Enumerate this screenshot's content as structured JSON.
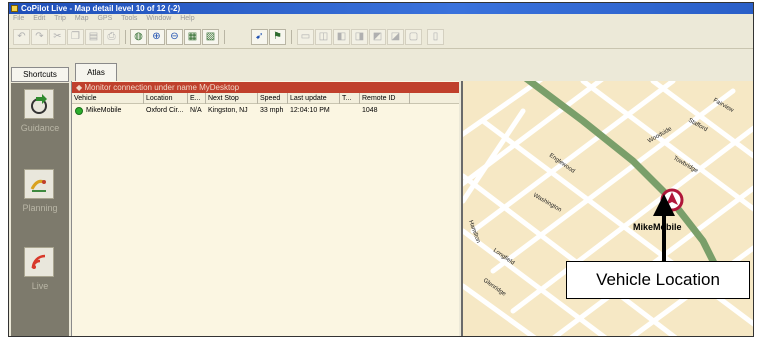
{
  "window": {
    "title": "CoPilot Live - Map detail level 10 of 12 (-2)"
  },
  "menubar": {
    "items": [
      "File",
      "Edit",
      "Trip",
      "Map",
      "GPS",
      "Tools",
      "Window",
      "Help"
    ]
  },
  "toolbar": {
    "buttons": [
      "undo-icon",
      "redo-icon",
      "cut-icon",
      "copy-icon",
      "paste-icon",
      "print-icon",
      "globe-icon",
      "zoom-in-icon",
      "zoom-out-icon",
      "map-full-icon",
      "map-window-icon",
      "satellite-icon",
      "gps-icon",
      "layers-icon"
    ]
  },
  "shortcuts": {
    "button_label": "Shortcuts",
    "items": [
      {
        "label": "Guidance",
        "icon": "guidance-icon"
      },
      {
        "label": "Planning",
        "icon": "planning-icon"
      },
      {
        "label": "Live",
        "icon": "live-icon"
      }
    ]
  },
  "tabs": {
    "atlas_label": "Atlas"
  },
  "monitor": {
    "banner": "Monitor connection under name MyDesktop"
  },
  "grid": {
    "columns": [
      "Vehicle",
      "Location",
      "E...",
      "Next Stop",
      "Speed",
      "Last update",
      "T...",
      "Remote ID"
    ],
    "rows": [
      [
        "MikeMobile",
        "Oxford Cir...",
        "N/A",
        "Kingston, NJ",
        "33 mph",
        "12:04:10 PM",
        "",
        "1048"
      ]
    ],
    "status_color": "#2cae2c"
  },
  "map": {
    "street_labels": [
      "Woodside",
      "Stafford",
      "Towbridge",
      "Englewood",
      "Washington",
      "Longfield",
      "Glenridge",
      "Fairview",
      "Hamilton"
    ],
    "vehicle_label": "MikeMobile",
    "road_color": "#ffffff",
    "highway_color": "#7a9f6a",
    "land_color": "#f6e8c5"
  },
  "callout": {
    "label": "Vehicle Location"
  }
}
